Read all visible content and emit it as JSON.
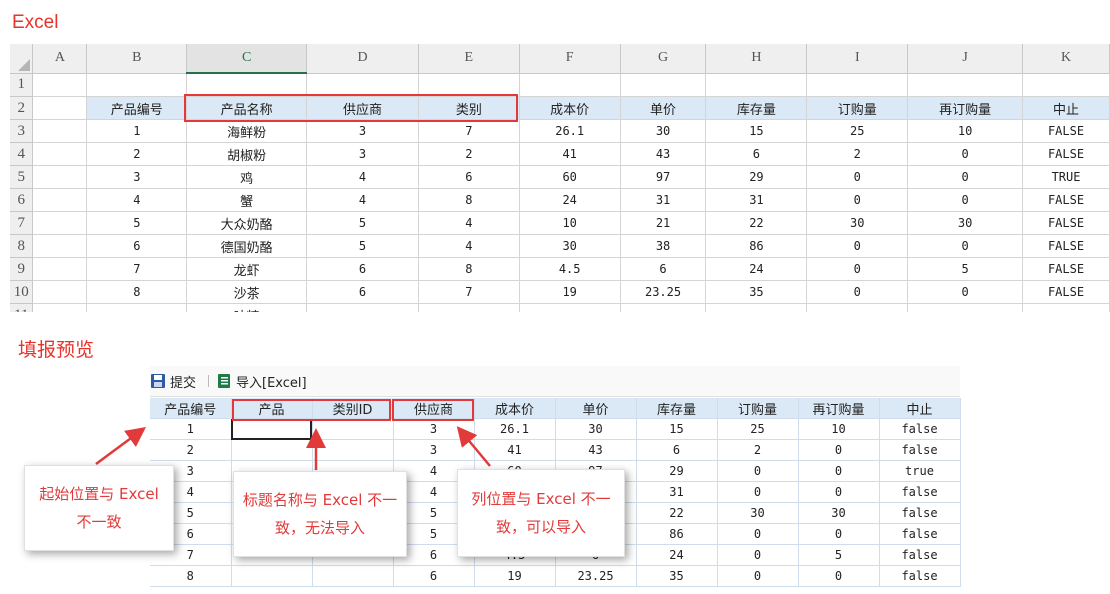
{
  "excel_title": "Excel",
  "preview_title": "填报预览",
  "sheet": {
    "columns": [
      "",
      "A",
      "B",
      "C",
      "D",
      "E",
      "F",
      "G",
      "H",
      "I",
      "J",
      "K"
    ],
    "selected_column": "C",
    "rows": [
      {
        "n": "1",
        "cells": [
          "",
          "",
          "",
          "",
          "",
          "",
          "",
          "",
          "",
          "",
          ""
        ]
      },
      {
        "n": "2",
        "cells": [
          "",
          "产品编号",
          "产品名称",
          "供应商",
          "类别",
          "成本价",
          "单价",
          "库存量",
          "订购量",
          "再订购量",
          "中止"
        ]
      },
      {
        "n": "3",
        "cells": [
          "",
          "1",
          "海鲜粉",
          "3",
          "7",
          "26.1",
          "30",
          "15",
          "25",
          "10",
          "FALSE"
        ]
      },
      {
        "n": "4",
        "cells": [
          "",
          "2",
          "胡椒粉",
          "3",
          "2",
          "41",
          "43",
          "6",
          "2",
          "0",
          "FALSE"
        ]
      },
      {
        "n": "5",
        "cells": [
          "",
          "3",
          "鸡",
          "4",
          "6",
          "60",
          "97",
          "29",
          "0",
          "0",
          "TRUE"
        ]
      },
      {
        "n": "6",
        "cells": [
          "",
          "4",
          "蟹",
          "4",
          "8",
          "24",
          "31",
          "31",
          "0",
          "0",
          "FALSE"
        ]
      },
      {
        "n": "7",
        "cells": [
          "",
          "5",
          "大众奶酪",
          "5",
          "4",
          "10",
          "21",
          "22",
          "30",
          "30",
          "FALSE"
        ]
      },
      {
        "n": "8",
        "cells": [
          "",
          "6",
          "德国奶酪",
          "5",
          "4",
          "30",
          "38",
          "86",
          "0",
          "0",
          "FALSE"
        ]
      },
      {
        "n": "9",
        "cells": [
          "",
          "7",
          "龙虾",
          "6",
          "8",
          "4.5",
          "6",
          "24",
          "0",
          "5",
          "FALSE"
        ]
      },
      {
        "n": "10",
        "cells": [
          "",
          "8",
          "沙茶",
          "6",
          "7",
          "19",
          "23.25",
          "35",
          "0",
          "0",
          "FALSE"
        ]
      },
      {
        "n": "11",
        "cells": [
          "",
          "",
          "味精",
          "",
          "",
          "",
          "",
          "",
          "",
          "",
          ""
        ]
      }
    ]
  },
  "toolbar": {
    "submit_label": "提交",
    "import_label": "导入[Excel]"
  },
  "preview": {
    "headers": [
      "产品编号",
      "产品",
      "类别ID",
      "供应商",
      "成本价",
      "单价",
      "库存量",
      "订购量",
      "再订购量",
      "中止"
    ],
    "rows": [
      [
        "1",
        "",
        "",
        "3",
        "26.1",
        "30",
        "15",
        "25",
        "10",
        "false"
      ],
      [
        "2",
        "",
        "",
        "3",
        "41",
        "43",
        "6",
        "2",
        "0",
        "false"
      ],
      [
        "3",
        "",
        "",
        "4",
        "60",
        "97",
        "29",
        "0",
        "0",
        "true"
      ],
      [
        "4",
        "",
        "",
        "4",
        "24",
        "31",
        "31",
        "0",
        "0",
        "false"
      ],
      [
        "5",
        "",
        "",
        "5",
        "10",
        "21",
        "22",
        "30",
        "30",
        "false"
      ],
      [
        "6",
        "",
        "",
        "5",
        "30",
        "38",
        "86",
        "0",
        "0",
        "false"
      ],
      [
        "7",
        "",
        "",
        "6",
        "4.5",
        "6",
        "24",
        "0",
        "5",
        "false"
      ],
      [
        "8",
        "",
        "",
        "6",
        "19",
        "23.25",
        "35",
        "0",
        "0",
        "false"
      ]
    ]
  },
  "callouts": {
    "start_position": "起始位置与 Excel 不一致",
    "title_mismatch": "标题名称与 Excel 不一致，无法导入",
    "column_mismatch": "列位置与 Excel 不一致，可以导入"
  },
  "colors": {
    "annotation": "#e23a3a",
    "header_fill": "#dbe9f6",
    "excel_green": "#217346"
  }
}
